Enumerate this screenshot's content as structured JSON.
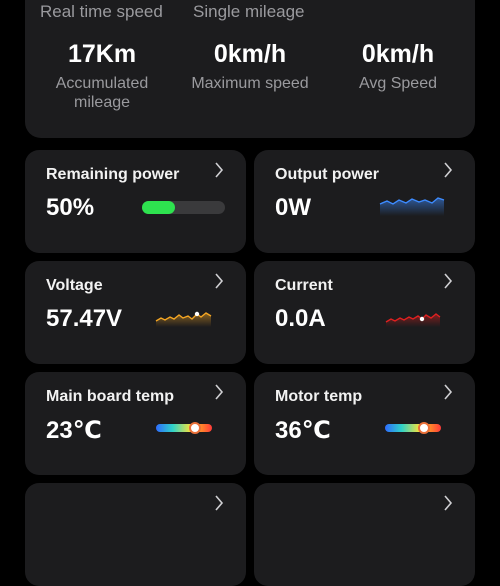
{
  "summary": {
    "top_left": "Real time speed",
    "top_mid": "Single mileage",
    "items": [
      {
        "value": "17Km",
        "label": "Accumulated mileage"
      },
      {
        "value": "0km/h",
        "label": "Maximum speed"
      },
      {
        "value": "0km/h",
        "label": "Avg Speed"
      }
    ]
  },
  "cards": {
    "remaining_power": {
      "title": "Remaining power",
      "value": "50%",
      "level": 0.5,
      "color": "#2ee24f"
    },
    "output_power": {
      "title": "Output power",
      "value": "0W",
      "color": "#3d8bff"
    },
    "voltage": {
      "title": "Voltage",
      "value": "57.47V",
      "color": "#f5a623"
    },
    "current": {
      "title": "Current",
      "value": "0.0A",
      "color": "#e02020"
    },
    "main_board_temp": {
      "title": "Main board temp",
      "value": "23℃",
      "level": 0.7
    },
    "motor_temp": {
      "title": "Motor temp",
      "value": "36℃",
      "level": 0.7
    }
  },
  "icons": {
    "chevron": "chevron-right-icon"
  }
}
